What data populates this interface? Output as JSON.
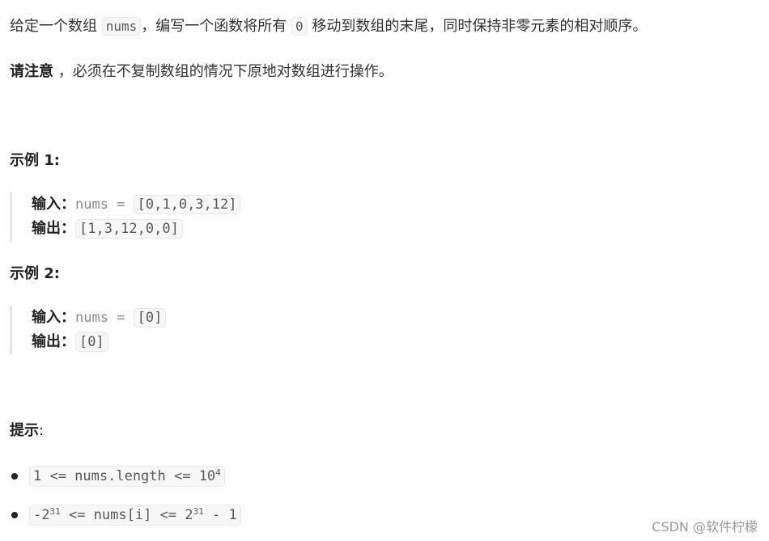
{
  "intro": {
    "part1": "给定一个数组 ",
    "code1": "nums",
    "part2": "，编写一个函数将所有 ",
    "code2": "0",
    "part3": " 移动到数组的末尾，同时保持非零元素的相对顺序。"
  },
  "note": {
    "bold": "请注意",
    "text": " ，必须在不复制数组的情况下原地对数组进行操作。"
  },
  "examples": [
    {
      "title": "示例 1:",
      "input_label": "输入：",
      "input_prefix": "nums = ",
      "input_value": "[0,1,0,3,12]",
      "output_label": "输出：",
      "output_value": "[1,3,12,0,0]"
    },
    {
      "title": "示例 2:",
      "input_label": "输入：",
      "input_prefix": "nums = ",
      "input_value": "[0]",
      "output_label": "输出：",
      "output_value": "[0]"
    }
  ],
  "hints": {
    "title": "提示",
    "colon": ":",
    "items": [
      {
        "pre": "1 <= nums.length <= 10",
        "sup": "4",
        "post": ""
      },
      {
        "pre": "-2",
        "sup": "31",
        "mid": " <= nums[i] <= 2",
        "sup2": "31",
        "post": " - 1"
      }
    ]
  },
  "watermark": "CSDN @软件柠檬"
}
